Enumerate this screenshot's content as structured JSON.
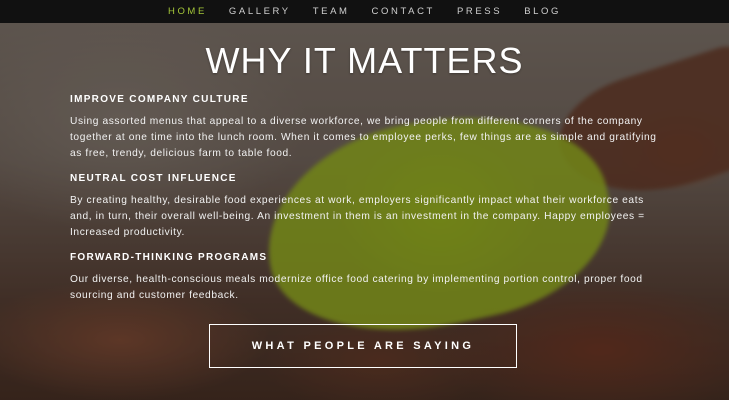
{
  "nav": {
    "items": [
      {
        "label": "HOME",
        "active": true
      },
      {
        "label": "GALLERY",
        "active": false
      },
      {
        "label": "TEAM",
        "active": false
      },
      {
        "label": "CONTACT",
        "active": false
      },
      {
        "label": "PRESS",
        "active": false
      },
      {
        "label": "BLOG",
        "active": false
      }
    ],
    "active_color": "#a4c639"
  },
  "main": {
    "title": "WHY IT MATTERS",
    "sections": [
      {
        "heading": "IMPROVE COMPANY CULTURE",
        "text": "Using assorted menus that appeal to a diverse workforce, we bring people from different corners of the company together at one time into the lunch room. When it comes to employee perks, few things are as simple and gratifying as free, trendy, delicious farm to table food."
      },
      {
        "heading": "NEUTRAL COST INFLUENCE",
        "text": "By creating healthy, desirable food experiences at work, employers significantly impact what their workforce eats and, in turn, their overall well-being. An investment in them is an investment in the company. Happy employees = Increased productivity."
      },
      {
        "heading": "FORWARD-THINKING PROGRAMS",
        "text": "Our diverse, health-conscious meals modernize office food catering by implementing portion control, proper food sourcing and customer feedback."
      }
    ],
    "cta_label": "WHAT PEOPLE ARE SAYING"
  }
}
